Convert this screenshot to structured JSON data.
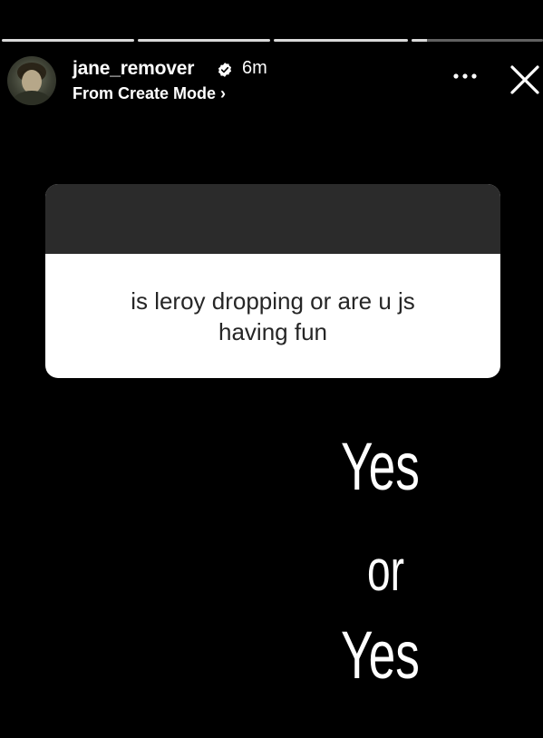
{
  "story": {
    "progress": [
      1.0,
      1.0,
      1.0,
      0.12
    ],
    "progress_color": "#d9d9d9"
  },
  "header": {
    "username": "jane_remover",
    "time": "6m",
    "subtitle": "From Create Mode ›",
    "verified_icon": "verified-badge-icon",
    "more_icon": "more-icon",
    "close_icon": "close-icon"
  },
  "question_sticker": {
    "text": "is leroy dropping or are u js having fun",
    "header_color": "#2b2b2b"
  },
  "answer": {
    "line1": "Yes",
    "line2": "or",
    "line3": "Yes"
  }
}
